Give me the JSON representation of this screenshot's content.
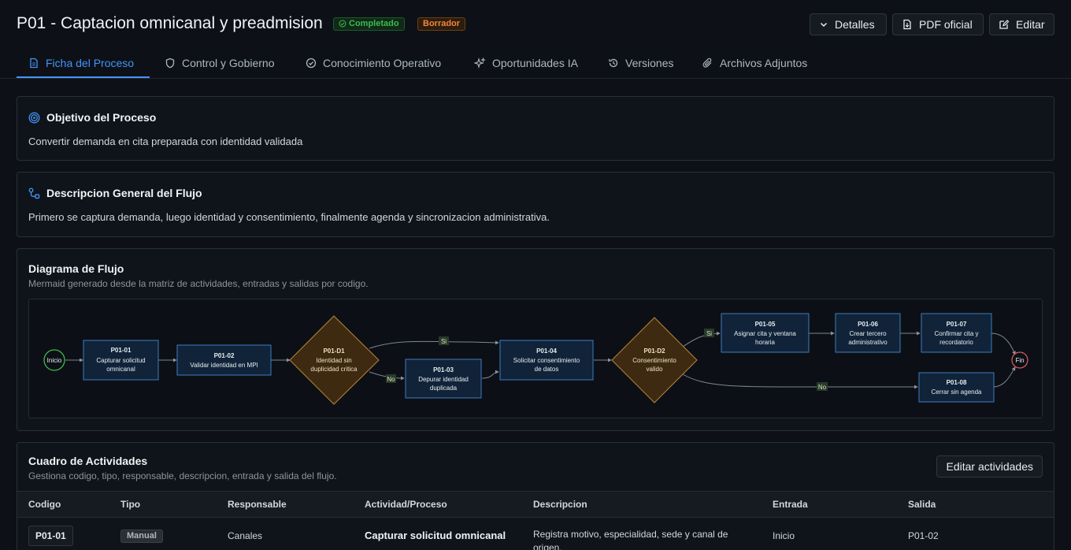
{
  "header": {
    "title": "P01 - Captacion omnicanal y preadmision",
    "status_badge": "Completado",
    "draft_badge": "Borrador",
    "details_label": "Detalles",
    "pdf_label": "PDF oficial",
    "edit_label": "Editar"
  },
  "tabs": [
    {
      "label": "Ficha del Proceso",
      "icon": "document-icon",
      "active": true
    },
    {
      "label": "Control y Gobierno",
      "icon": "shield-icon"
    },
    {
      "label": "Conocimiento Operativo",
      "icon": "check-circle-icon"
    },
    {
      "label": "Oportunidades IA",
      "icon": "sparkles-icon"
    },
    {
      "label": "Versiones",
      "icon": "history-icon"
    },
    {
      "label": "Archivos Adjuntos",
      "icon": "paperclip-icon"
    }
  ],
  "objective": {
    "title": "Objetivo del Proceso",
    "text": "Convertir demanda en cita preparada con identidad validada"
  },
  "description": {
    "title": "Descripcion General del Flujo",
    "text": "Primero se captura demanda, luego identidad y consentimiento, finalmente agenda y sincronizacion administrativa."
  },
  "diagram": {
    "title": "Diagrama de Flujo",
    "subtitle": "Mermaid generado desde la matriz de actividades, entradas y salidas por codigo.",
    "start": "Inicio",
    "end": "Fin",
    "nodes": {
      "n1": {
        "code": "P01-01",
        "lines": [
          "Capturar solicitud",
          "omnicanal"
        ]
      },
      "n2": {
        "code": "P01-02",
        "lines": [
          "Validar identidad en MPI"
        ]
      },
      "d1": {
        "code": "P01-D1",
        "lines": [
          "Identidad sin",
          "duplicidad critica"
        ]
      },
      "n3": {
        "code": "P01-03",
        "lines": [
          "Depurar identidad",
          "duplicada"
        ]
      },
      "n4": {
        "code": "P01-04",
        "lines": [
          "Solicitar consentimiento",
          "de datos"
        ]
      },
      "d2": {
        "code": "P01-D2",
        "lines": [
          "Consentimiento",
          "valido"
        ]
      },
      "n5": {
        "code": "P01-05",
        "lines": [
          "Asignar cita y ventana",
          "horaria"
        ]
      },
      "n6": {
        "code": "P01-06",
        "lines": [
          "Crear tercero",
          "administrativo"
        ]
      },
      "n7": {
        "code": "P01-07",
        "lines": [
          "Confirmar cita y",
          "recordatorio"
        ]
      },
      "n8": {
        "code": "P01-08",
        "lines": [
          "Cerrar sin agenda"
        ]
      }
    },
    "labels": {
      "yes": "Si",
      "no": "No"
    }
  },
  "activities": {
    "title": "Cuadro de Actividades",
    "subtitle": "Gestiona codigo, tipo, responsable, descripcion, entrada y salida del flujo.",
    "edit_button": "Editar actividades",
    "columns": {
      "code": "Codigo",
      "type": "Tipo",
      "owner": "Responsable",
      "activity": "Actividad/Proceso",
      "description": "Descripcion",
      "input": "Entrada",
      "output": "Salida"
    },
    "rows": [
      {
        "code": "P01-01",
        "type": "Manual",
        "owner": "Canales",
        "activity": "Capturar solicitud omnicanal",
        "description_line1": "Registra motivo, especialidad, sede y canal de",
        "description_line2": "origen.",
        "input": "Inicio",
        "output": "P01-02"
      }
    ]
  },
  "colors": {
    "accent": "#4493f8",
    "success": "#3fb950",
    "draft": "#f0883e",
    "node_fill": "#112338",
    "node_stroke": "#3d7cc0",
    "decision_fill": "#3d2a10",
    "decision_stroke": "#b8853a",
    "end_stroke": "#e05a5a"
  }
}
